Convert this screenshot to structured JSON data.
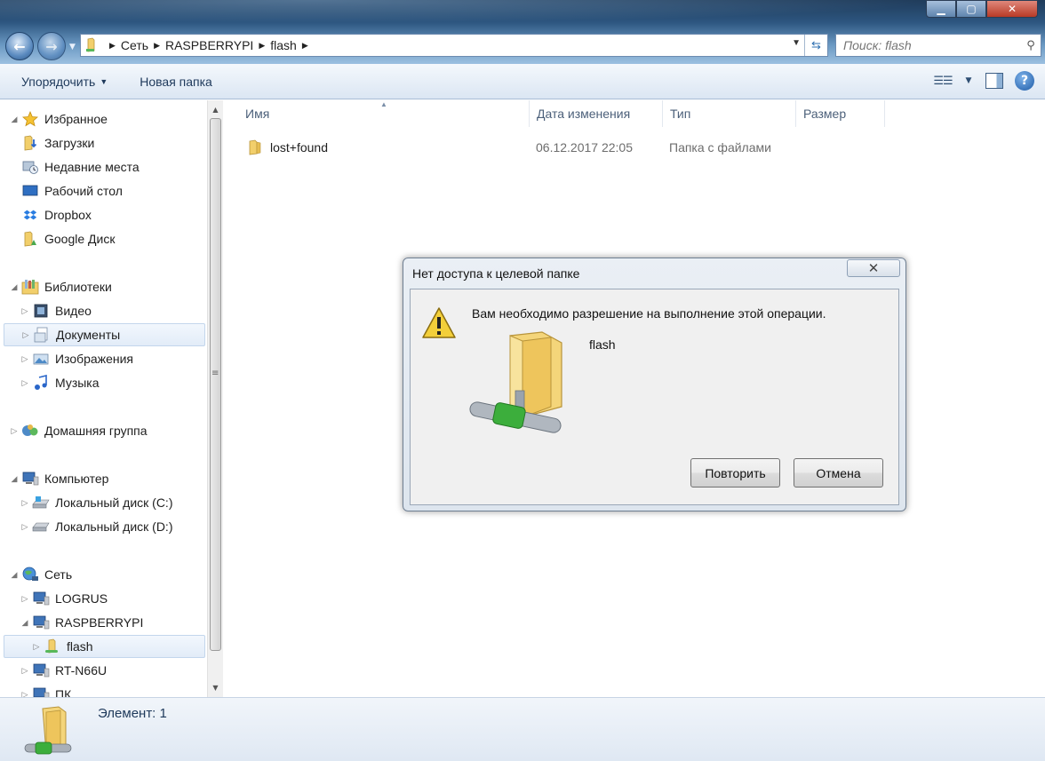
{
  "address": {
    "crumbs": [
      "Сеть",
      "RASPBERRYPI",
      "flash"
    ]
  },
  "search": {
    "placeholder": "Поиск: flash"
  },
  "toolbar": {
    "organize": "Упорядочить",
    "new_folder": "Новая папка"
  },
  "nav": {
    "favorites": "Избранное",
    "downloads": "Загрузки",
    "recent": "Недавние места",
    "desktop": "Рабочий стол",
    "dropbox": "Dropbox",
    "google_drive": "Google Диск",
    "libraries": "Библиотеки",
    "video": "Видео",
    "documents": "Документы",
    "images": "Изображения",
    "music": "Музыка",
    "homegroup": "Домашняя группа",
    "computer": "Компьютер",
    "disk_c": "Локальный диск (C:)",
    "disk_d": "Локальный диск (D:)",
    "network": "Сеть",
    "logrus": "LOGRUS",
    "raspberrypi": "RASPBERRYPI",
    "flash": "flash",
    "rtn66u": "RT-N66U",
    "pk": "ПК"
  },
  "columns": {
    "name": "Имя",
    "date": "Дата изменения",
    "type": "Тип",
    "size": "Размер"
  },
  "files": [
    {
      "name": "lost+found",
      "date": "06.12.2017 22:05",
      "type": "Папка с файлами",
      "size": ""
    }
  ],
  "status": {
    "text": "Элемент: 1"
  },
  "dialog": {
    "title": "Нет доступа к целевой папке",
    "message": "Вам необходимо разрешение на выполнение этой операции.",
    "folder": "flash",
    "retry": "Повторить",
    "cancel": "Отмена"
  },
  "colors": {
    "folder": "#f2cf6b",
    "accent": "#1e395b",
    "network_green": "#3cae3c"
  }
}
